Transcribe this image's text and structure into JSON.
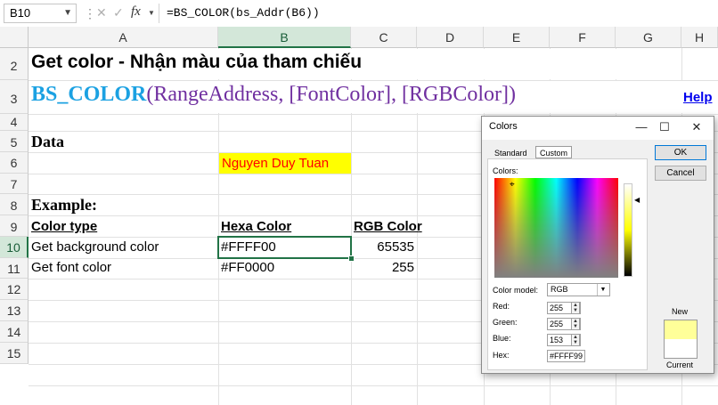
{
  "formula_bar": {
    "name_box": "B10",
    "formula": "=BS_COLOR(bs_Addr(B6))",
    "icons": [
      "cancel-icon",
      "enter-icon",
      "function-icon"
    ],
    "fx_label": "fx"
  },
  "columns": [
    "A",
    "B",
    "C",
    "D",
    "E",
    "F",
    "G",
    "H"
  ],
  "rows": [
    "2",
    "3",
    "4",
    "5",
    "6",
    "7",
    "8",
    "9",
    "10",
    "11",
    "12",
    "13",
    "14",
    "15"
  ],
  "selected": {
    "column": "B",
    "row": "10"
  },
  "cells": {
    "a2": "Get color - Nhận màu của tham chiếu",
    "a3_func": "BS_COLOR",
    "a3_open": "(",
    "a3_args": "RangeAddress, [FontColor], [RGBColor]",
    "a3_close": ")",
    "help_link": "Help",
    "a5": "Data",
    "b6": "Nguyen Duy Tuan",
    "a8": "Example:",
    "a9": "Color type",
    "b9": "Hexa Color",
    "c9": "RGB Color",
    "a10": "Get background color",
    "b10": "#FFFF00",
    "c10": "65535",
    "a11": "Get font color",
    "b11": "#FF0000",
    "c11": "255"
  },
  "colors": {
    "accent_green": "#217346",
    "b6_fill": "#FFFF00",
    "b6_text": "#FF0000",
    "func_color": "#1ba1e2",
    "args_color": "#7030a0",
    "help_color": "#0000ee",
    "new_color": "#FFFF99"
  },
  "dialog": {
    "title": "Colors",
    "tabs": [
      "Standard",
      "Custom"
    ],
    "active_tab": "Custom",
    "colors_label": "Colors:",
    "color_model_label": "Color model:",
    "color_model": "RGB",
    "red_label": "Red:",
    "red": "255",
    "green_label": "Green:",
    "green": "255",
    "blue_label": "Blue:",
    "blue": "153",
    "hex_label": "Hex:",
    "hex": "#FFFF99",
    "ok": "OK",
    "cancel": "Cancel",
    "new_label": "New",
    "current_label": "Current"
  }
}
